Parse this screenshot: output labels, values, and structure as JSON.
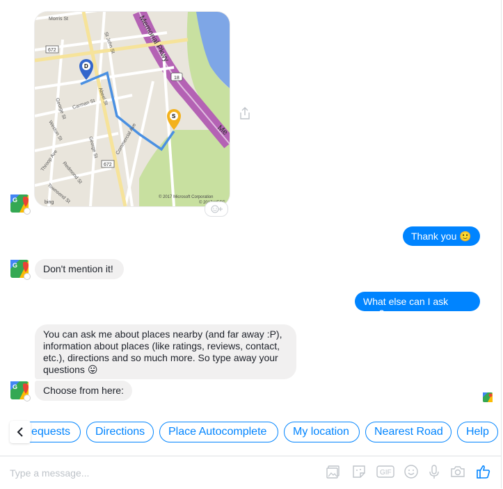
{
  "map": {
    "streets": [
      "Morris St",
      "St John St",
      "Memorial Pkwy",
      "Me",
      "George St",
      "Abeel St",
      "Carman St",
      "Weston St",
      "Commercial Ave",
      "Throop Ave",
      "Redmond St",
      "Townsend St",
      "Ave",
      "George St"
    ],
    "route_shields": [
      "672",
      "18",
      "672"
    ],
    "markers": {
      "destination": "D",
      "start": "S"
    },
    "copyright": "© 2017 Microsoft Corporation",
    "copyright2": "© 2017 HERE",
    "provider": "bing"
  },
  "messages": [
    {
      "from": "user",
      "text": "Thank you 🙂"
    },
    {
      "from": "bot",
      "text": "Don't mention it!"
    },
    {
      "from": "user",
      "text": "What else can I ask you?"
    },
    {
      "from": "bot",
      "text": "You can ask me about places nearby (and far away :P), information about places (like ratings, reviews, contact, etc.), directions and so much more. So type away your questions 😛"
    },
    {
      "from": "bot",
      "text": "Choose from here:"
    }
  ],
  "quick_replies": [
    "equests",
    "Directions",
    "Place Autocomplete",
    "My location",
    "Nearest Road",
    "Help"
  ],
  "composer": {
    "placeholder": "Type a message...",
    "gif_label": "GIF"
  },
  "icons": [
    "share-icon",
    "add-reaction-icon",
    "chevron-left-icon",
    "image-icon",
    "sticker-icon",
    "gif-icon",
    "emoji-icon",
    "microphone-icon",
    "camera-icon",
    "thumbs-up-icon"
  ],
  "colors": {
    "accent": "#0084ff",
    "incoming_bubble": "#f1f0f0",
    "park": "#c8e0a0",
    "water": "#7ea6e6",
    "parkway": "#b462b4",
    "route": "#4a90e2",
    "start_marker": "#f3b11c",
    "dest_marker": "#3366cc"
  }
}
